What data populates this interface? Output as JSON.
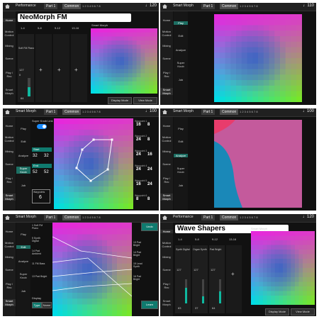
{
  "header": {
    "performance_label": "Performance",
    "smart_morph_label": "Smart Morph",
    "part_tab": "Part 1",
    "common_tab": "Common",
    "part_numbers": "1 2 3 4 5 6 7 8",
    "tempo_icon": "note-icon",
    "tempo_1": "120",
    "tempo_2": "110",
    "tempo_3": "100",
    "tempo_4": "100",
    "tempo_5": "120"
  },
  "side_menu": [
    "Home",
    "Motion Control",
    "Mixing",
    "Scene",
    "Play / Rec",
    "Smart Morph"
  ],
  "sub_menu": [
    "Play",
    "Edit",
    "Analyze",
    "Super Knob",
    "Job"
  ],
  "panel_tl": {
    "title": "NeoMorph FM",
    "part_groups": [
      "1-4",
      "5-8",
      "9-12",
      "13-16"
    ],
    "smart_morph_label": "Smart Morph",
    "part_name": "Soft FM Piano",
    "display_mode": "Display Mode",
    "view_mode": "View Mode",
    "volume": "64",
    "values": [
      "127",
      "0"
    ]
  },
  "panel_ml": {
    "super_knob_link": "Super Knob Link",
    "start_label": "Start",
    "end_label": "End",
    "start_values": [
      "32",
      "32"
    ],
    "end_values": [
      "52",
      "52"
    ],
    "waypoints_label": "Waypoints",
    "waypoints_value": "6",
    "waypoint_labels": [
      "Waypoint 1",
      "Waypoint 2",
      "Waypoint 3",
      "Waypoint 4",
      "Waypoint 5",
      "Waypoint 6"
    ],
    "waypoint_values": [
      [
        "16",
        "8"
      ],
      [
        "24",
        "8"
      ],
      [
        "24",
        "16"
      ],
      [
        "24",
        "24"
      ],
      [
        "16",
        "24"
      ],
      [
        "8",
        "8"
      ]
    ]
  },
  "panel_bl": {
    "display_label": "Display",
    "type_label": "Type",
    "name_label": "Name",
    "undo": "Undo",
    "learn": "Learn",
    "list_left": [
      "1 Soft FM Piano",
      "5 Synth Digital",
      "14 Pad Ambient",
      "11 FM Bass",
      "13 Pad Bright"
    ],
    "list_right": [
      "13 Pad Bright",
      "14 Pad Bright",
      "15 Lead Synth",
      "16 Pad Bright"
    ]
  },
  "panel_br": {
    "title": "Wave Shapers",
    "part_groups": [
      "1-4",
      "5-8",
      "9-12",
      "13-16"
    ],
    "smart_morph_label": "Smart Morph",
    "display_mode": "Display Mode",
    "view_mode": "View Mode",
    "part_names": [
      "Synth Digital",
      "Organ Synth",
      "Pad Bright"
    ],
    "values": [
      "127",
      "127",
      "127"
    ],
    "bottom_values": [
      "83",
      "37",
      "64"
    ]
  }
}
